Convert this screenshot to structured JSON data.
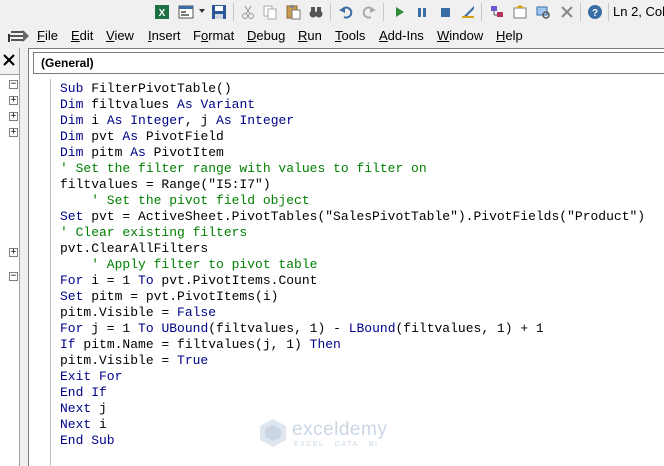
{
  "status": {
    "position": "Ln 2, Col"
  },
  "menu": [
    {
      "id": "file",
      "prefix": "",
      "ul": "F",
      "rest": "ile"
    },
    {
      "id": "edit",
      "prefix": "",
      "ul": "E",
      "rest": "dit"
    },
    {
      "id": "view",
      "prefix": "",
      "ul": "V",
      "rest": "iew"
    },
    {
      "id": "insert",
      "prefix": "",
      "ul": "I",
      "rest": "nsert"
    },
    {
      "id": "format",
      "prefix": "F",
      "ul": "o",
      "rest": "rmat"
    },
    {
      "id": "debug",
      "prefix": "",
      "ul": "D",
      "rest": "ebug"
    },
    {
      "id": "run",
      "prefix": "",
      "ul": "R",
      "rest": "un"
    },
    {
      "id": "tools",
      "prefix": "",
      "ul": "T",
      "rest": "ools"
    },
    {
      "id": "addins",
      "prefix": "",
      "ul": "A",
      "rest": "dd-Ins"
    },
    {
      "id": "window",
      "prefix": "",
      "ul": "W",
      "rest": "indow"
    },
    {
      "id": "help",
      "prefix": "",
      "ul": "H",
      "rest": "elp"
    }
  ],
  "object_box": {
    "value": "(General)"
  },
  "code_lines": [
    [
      [
        "kw",
        "Sub"
      ],
      [
        "t",
        " FilterPivotTable()"
      ]
    ],
    [
      [
        "kw",
        "Dim"
      ],
      [
        "t",
        " filtvalues "
      ],
      [
        "kw",
        "As"
      ],
      [
        "t",
        " "
      ],
      [
        "kw",
        "Variant"
      ]
    ],
    [
      [
        "kw",
        "Dim"
      ],
      [
        "t",
        " i "
      ],
      [
        "kw",
        "As"
      ],
      [
        "t",
        " "
      ],
      [
        "kw",
        "Integer"
      ],
      [
        "t",
        ", j "
      ],
      [
        "kw",
        "As"
      ],
      [
        "t",
        " "
      ],
      [
        "kw",
        "Integer"
      ]
    ],
    [
      [
        "kw",
        "Dim"
      ],
      [
        "t",
        " pvt "
      ],
      [
        "kw",
        "As"
      ],
      [
        "t",
        " PivotField"
      ]
    ],
    [
      [
        "kw",
        "Dim"
      ],
      [
        "t",
        " pitm "
      ],
      [
        "kw",
        "As"
      ],
      [
        "t",
        " PivotItem"
      ]
    ],
    [
      [
        "cm",
        "' Set the filter range with values to filter on"
      ]
    ],
    [
      [
        "t",
        "filtvalues = Range(\"I5:I7\")"
      ]
    ],
    [
      [
        "cm",
        "    ' Set the pivot field object"
      ]
    ],
    [
      [
        "kw",
        "Set"
      ],
      [
        "t",
        " pvt = ActiveSheet.PivotTables(\"SalesPivotTable\").PivotFields(\"Product\")"
      ]
    ],
    [
      [
        "cm",
        "' Clear existing filters"
      ]
    ],
    [
      [
        "t",
        "pvt.ClearAllFilters"
      ]
    ],
    [
      [
        "cm",
        "    ' Apply filter to pivot table"
      ]
    ],
    [
      [
        "kw",
        "For"
      ],
      [
        "t",
        " i = 1 "
      ],
      [
        "kw",
        "To"
      ],
      [
        "t",
        " pvt.PivotItems.Count"
      ]
    ],
    [
      [
        "kw",
        "Set"
      ],
      [
        "t",
        " pitm = pvt.PivotItems(i)"
      ]
    ],
    [
      [
        "t",
        "pitm.Visible = "
      ],
      [
        "kw",
        "False"
      ]
    ],
    [
      [
        "kw",
        "For"
      ],
      [
        "t",
        " j = 1 "
      ],
      [
        "kw",
        "To"
      ],
      [
        "t",
        " "
      ],
      [
        "kw",
        "UBound"
      ],
      [
        "t",
        "(filtvalues, 1) - "
      ],
      [
        "kw",
        "LBound"
      ],
      [
        "t",
        "(filtvalues, 1) + 1"
      ]
    ],
    [
      [
        "kw",
        "If"
      ],
      [
        "t",
        " pitm.Name = filtvalues(j, 1) "
      ],
      [
        "kw",
        "Then"
      ]
    ],
    [
      [
        "t",
        "pitm.Visible = "
      ],
      [
        "kw",
        "True"
      ]
    ],
    [
      [
        "kw",
        "Exit For"
      ]
    ],
    [
      [
        "kw",
        "End If"
      ]
    ],
    [
      [
        "kw",
        "Next"
      ],
      [
        "t",
        " j"
      ]
    ],
    [
      [
        "kw",
        "Next"
      ],
      [
        "t",
        " i"
      ]
    ],
    [
      [
        "kw",
        "End Sub"
      ]
    ]
  ],
  "watermark": {
    "name": "exceldemy",
    "tagline": "EXCEL · DATA · BI"
  },
  "colors": {
    "keyword": "#00008b",
    "comment": "#008000",
    "text": "#000000"
  }
}
